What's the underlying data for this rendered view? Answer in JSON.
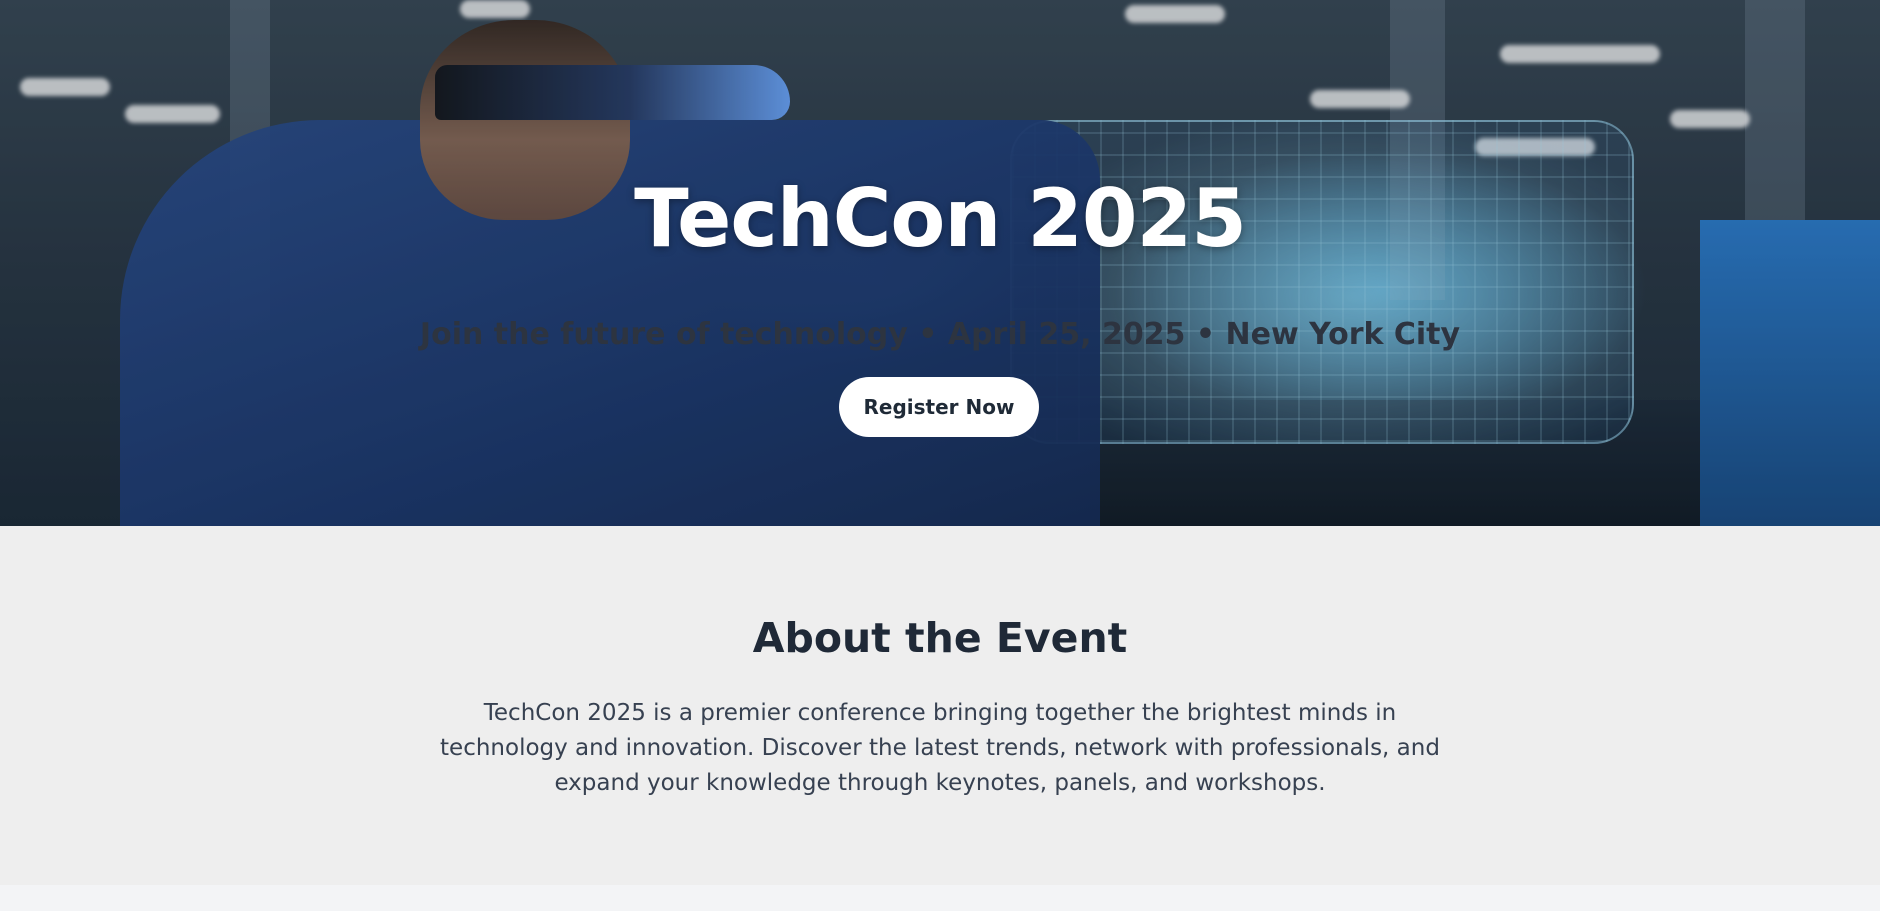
{
  "hero": {
    "title": "TechCon 2025",
    "subtitle": "Join the future of technology • April 25, 2025 • New York City",
    "register_label": "Register Now"
  },
  "about": {
    "title": "About the Event",
    "text": "TechCon 2025 is a premier conference bringing together the brightest minds in technology and innovation. Discover the latest trends, network with professionals, and expand your knowledge through keynotes, panels, and workshops."
  },
  "colors": {
    "hero_title": "#ffffff",
    "hero_subtitle": "#2d3440",
    "button_bg": "#ffffff",
    "button_text": "#1f2a37",
    "about_bg": "#eeeeee",
    "heading": "#1f2937",
    "body_text": "#374151"
  }
}
